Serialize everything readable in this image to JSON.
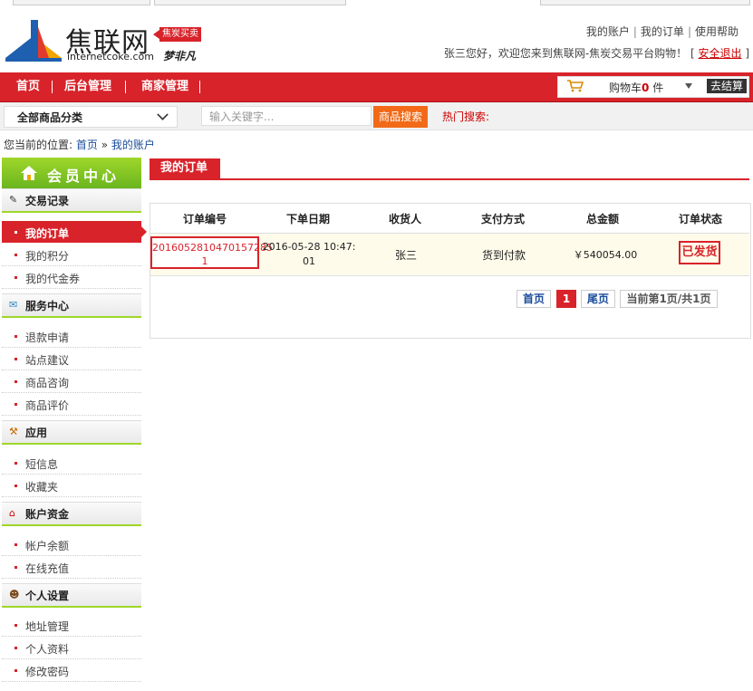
{
  "header": {
    "logo_name": "焦联网",
    "logo_url": "internetcoke.com",
    "logo_tag": "焦炭买卖",
    "logo_sign": "梦非凡",
    "top_links": [
      "我的账户",
      "我的订单",
      "使用帮助"
    ],
    "welcome_text": "张三您好，欢迎您来到焦联网-焦炭交易平台购物！",
    "logout_label": "安全退出"
  },
  "nav": {
    "items": [
      "首页",
      "后台管理",
      "商家管理"
    ],
    "cart_label": "购物车",
    "cart_count": "0",
    "cart_unit": "件",
    "checkout_label": "去结算"
  },
  "search": {
    "category_label": "全部商品分类",
    "placeholder": "输入关键字...",
    "button_label": "商品搜索",
    "hot_label": "热门搜索:"
  },
  "breadcrumb": {
    "prefix": "您当前的位置:",
    "home": "首页",
    "sep": "»",
    "current": "我的账户"
  },
  "sidebar": {
    "title": "会员中心",
    "sections": [
      {
        "title": "交易记录",
        "items": [
          "我的订单",
          "我的积分",
          "我的代金券"
        ]
      },
      {
        "title": "服务中心",
        "items": [
          "退款申请",
          "站点建议",
          "商品咨询",
          "商品评价"
        ]
      },
      {
        "title": "应用",
        "items": [
          "短信息",
          "收藏夹"
        ]
      },
      {
        "title": "账户资金",
        "items": [
          "帐户余额",
          "在线充值"
        ]
      },
      {
        "title": "个人设置",
        "items": [
          "地址管理",
          "个人资料",
          "修改密码"
        ]
      }
    ]
  },
  "main": {
    "tab_title": "我的订单",
    "columns": [
      "订单编号",
      "下单日期",
      "收货人",
      "支付方式",
      "总金额",
      "订单状态"
    ],
    "rows": [
      {
        "order_no_line1": "2016052810470157285",
        "order_no_line2": "1",
        "date_line1": "2016-05-28 10:47:",
        "date_line2": "01",
        "receiver": "张三",
        "payment": "货到付款",
        "amount": "￥540054.00",
        "status": "已发货"
      }
    ],
    "pager": {
      "first": "首页",
      "current": "1",
      "last": "尾页",
      "info": "当前第1页/共1页"
    }
  },
  "colors": {
    "brand_red": "#d8232a",
    "green": "#7cc423",
    "orange": "#f26a17"
  }
}
